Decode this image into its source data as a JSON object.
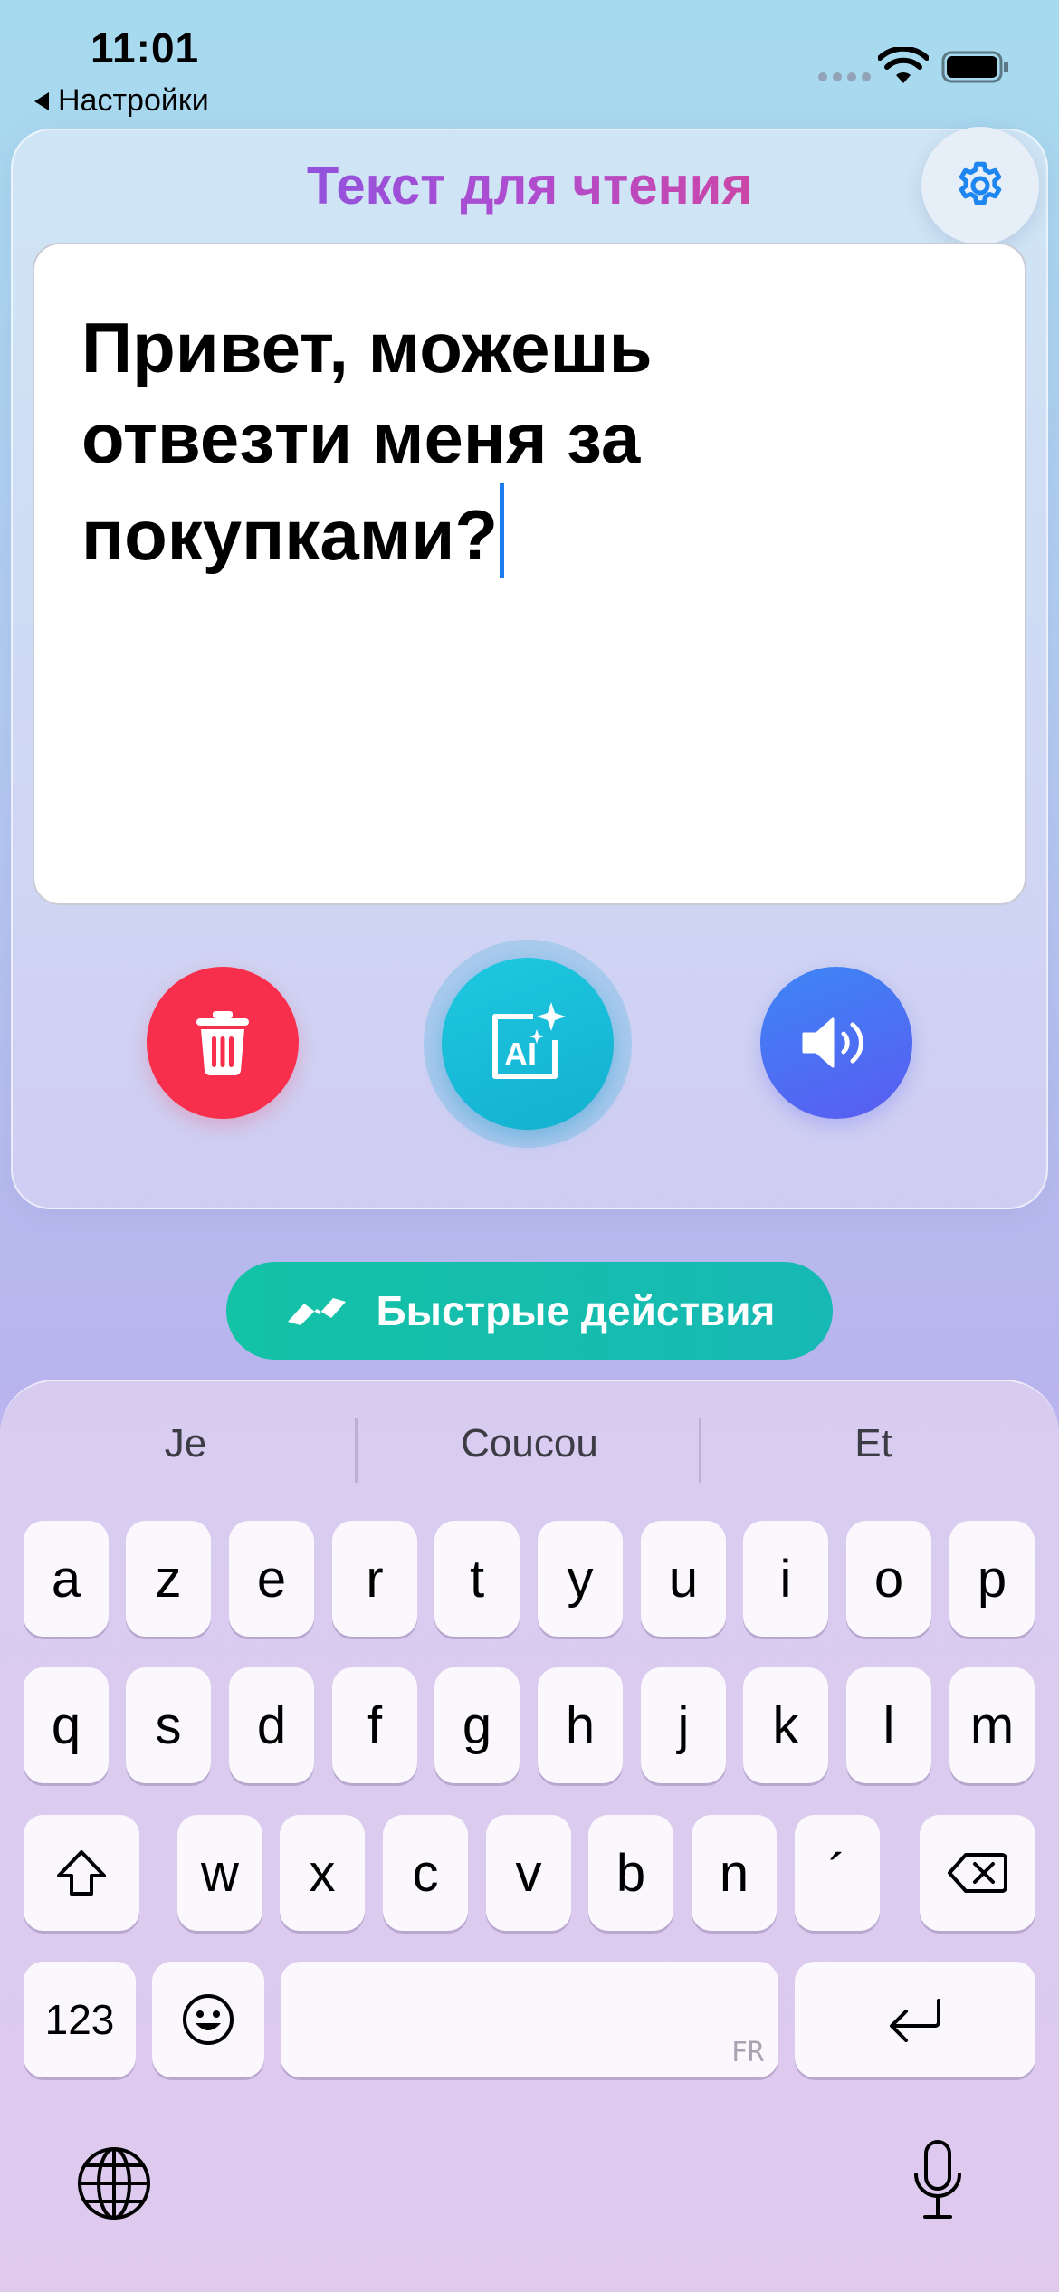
{
  "status_bar": {
    "time": "11:01",
    "back_label": "Настройки"
  },
  "card": {
    "title": "Текст для чтения",
    "text": "Привет, можешь отвезти меня за покупками?"
  },
  "icons": {
    "settings": "gear-icon",
    "trash": "trash-icon",
    "ai": "ai-sparkle-icon",
    "speaker": "speaker-icon",
    "quick": "wave-icon",
    "globe": "globe-icon",
    "mic": "microphone-icon"
  },
  "quick_actions": {
    "label": "Быстрые действия"
  },
  "keyboard": {
    "suggestions": [
      "Je",
      "Coucou",
      "Et"
    ],
    "row1": [
      "a",
      "z",
      "e",
      "r",
      "t",
      "y",
      "u",
      "i",
      "o",
      "p"
    ],
    "row2": [
      "q",
      "s",
      "d",
      "f",
      "g",
      "h",
      "j",
      "k",
      "l",
      "m"
    ],
    "row3": [
      "w",
      "x",
      "c",
      "v",
      "b",
      "n",
      "´"
    ],
    "numbers_label": "123",
    "space_lang": "FR"
  },
  "colors": {
    "trash": "#f72f4c",
    "ai": "#16bcd6",
    "speaker": "#4a72f4",
    "quick": "#14c2a6",
    "caret": "#1e7cf2"
  }
}
